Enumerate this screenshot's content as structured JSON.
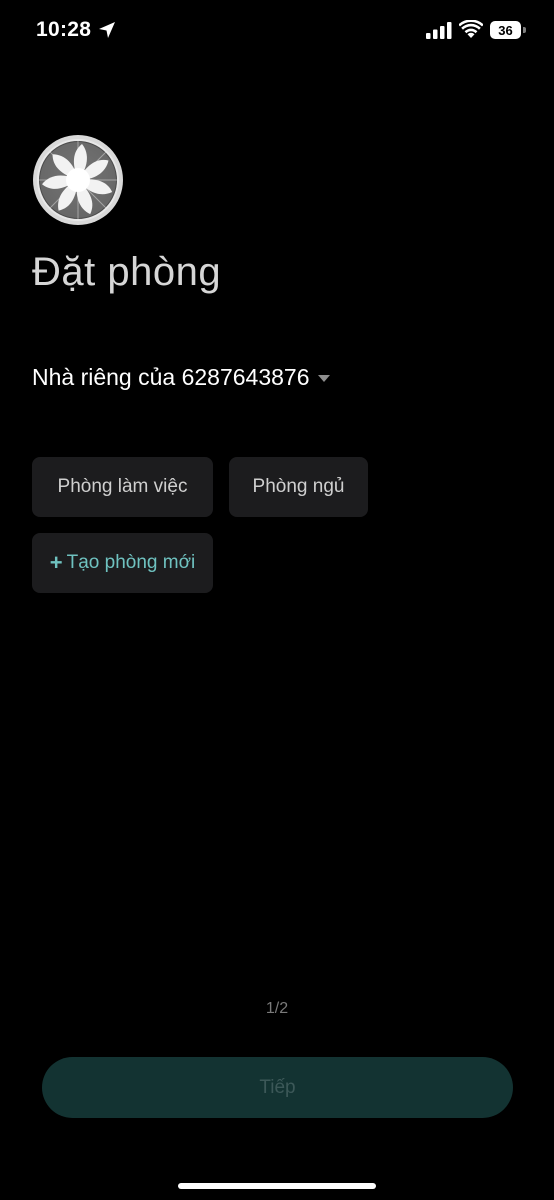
{
  "status_bar": {
    "time": "10:28",
    "battery": "36",
    "icons": [
      "location-arrow-icon",
      "signal-icon",
      "wifi-icon",
      "battery-icon"
    ]
  },
  "device": {
    "icon": "fan-icon"
  },
  "title": "Đặt phòng",
  "home": {
    "label": "Nhà riêng của 6287643876",
    "icon": "caret-down-icon"
  },
  "rooms": [
    {
      "label": "Phòng làm việc"
    },
    {
      "label": "Phòng ngủ"
    }
  ],
  "new_room": {
    "plus": "+",
    "label": "Tạo phòng mới"
  },
  "pager": "1/2",
  "next_label": "Tiếp",
  "colors": {
    "background": "#000000",
    "accent": "#6fc2c0",
    "button_bg": "#1c1c1e",
    "next_bg": "#133332"
  }
}
